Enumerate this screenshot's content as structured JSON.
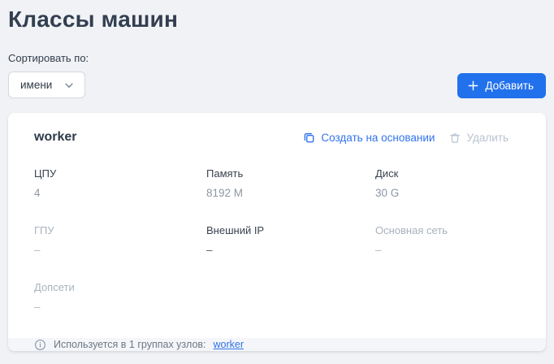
{
  "page": {
    "title": "Классы машин"
  },
  "toolbar": {
    "sort_label": "Сортировать по:",
    "sort_value": "имени",
    "add_label": "Добавить"
  },
  "card": {
    "name": "worker",
    "actions": {
      "create_from_label": "Создать на основании",
      "delete_label": "Удалить"
    },
    "fields": [
      {
        "label": "ЦПУ",
        "value": "4"
      },
      {
        "label": "Память",
        "value": "8192 M"
      },
      {
        "label": "Диск",
        "value": "30 G"
      },
      {
        "label": "ГПУ",
        "value": "–"
      },
      {
        "label": "Внешний IP",
        "value": "–"
      },
      {
        "label": "Основная сеть",
        "value": "–"
      },
      {
        "label": "Допсети",
        "value": "–"
      }
    ],
    "footer": {
      "text": "Используется в 1 группах узлов:",
      "link_label": "worker"
    }
  },
  "colors": {
    "accent": "#2271ec",
    "link": "#3173ee",
    "footer_link": "#2f72e8",
    "disabled": "#b9c3d1",
    "background": "#f0f2f5",
    "card_background": "#ffffff",
    "footer_background": "#f4f6f9"
  }
}
